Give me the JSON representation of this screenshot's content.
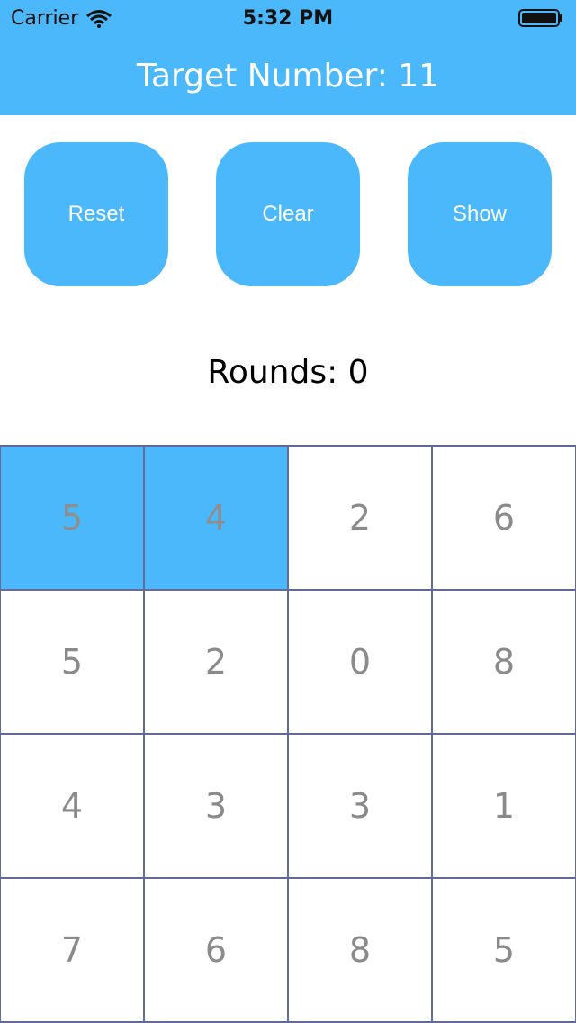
{
  "status_bar": {
    "carrier": "Carrier",
    "time": "5:32 PM"
  },
  "header": {
    "title": "Target Number: 11",
    "color": "#4ab8fa"
  },
  "buttons": {
    "reset": "Reset",
    "clear": "Clear",
    "show": "Show"
  },
  "rounds": "Rounds: 0",
  "grid": {
    "cells": [
      {
        "value": "5",
        "selected": true
      },
      {
        "value": "4",
        "selected": true
      },
      {
        "value": "2",
        "selected": false
      },
      {
        "value": "6",
        "selected": false
      },
      {
        "value": "5",
        "selected": false
      },
      {
        "value": "2",
        "selected": false
      },
      {
        "value": "0",
        "selected": false
      },
      {
        "value": "8",
        "selected": false
      },
      {
        "value": "4",
        "selected": false
      },
      {
        "value": "3",
        "selected": false
      },
      {
        "value": "3",
        "selected": false
      },
      {
        "value": "1",
        "selected": false
      },
      {
        "value": "7",
        "selected": false
      },
      {
        "value": "6",
        "selected": false
      },
      {
        "value": "8",
        "selected": false
      },
      {
        "value": "5",
        "selected": false
      }
    ]
  }
}
